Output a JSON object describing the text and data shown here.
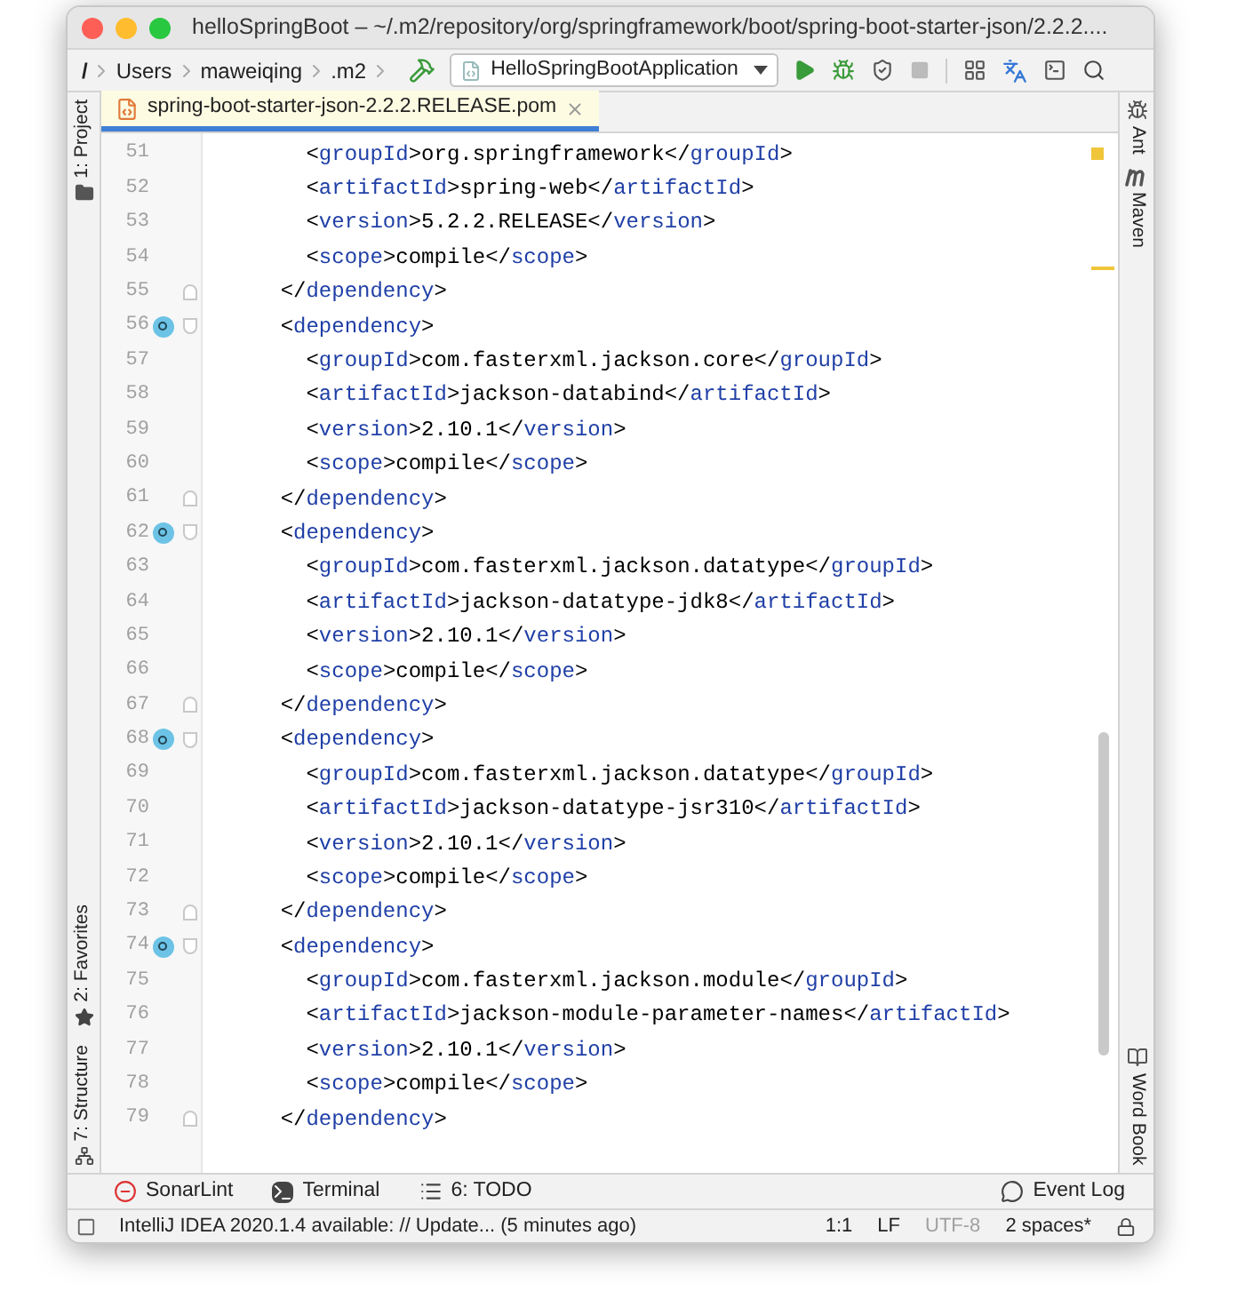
{
  "window": {
    "title": "helloSpringBoot – ~/.m2/repository/org/springframework/boot/spring-boot-starter-json/2.2.2...."
  },
  "breadcrumbs": [
    "/",
    "Users",
    "maweiqing",
    ".m2"
  ],
  "run_config": {
    "label": "HelloSpringBootApplication"
  },
  "left_sidebar": {
    "top": [
      {
        "label": "1: Project",
        "kind": "project"
      }
    ],
    "bottom": [
      {
        "label": "2: Favorites",
        "kind": "favorites"
      },
      {
        "label": "7: Structure",
        "kind": "structure"
      }
    ]
  },
  "tabs": [
    {
      "label": "spring-boot-starter-json-2.2.2.RELEASE.pom",
      "selected": true
    }
  ],
  "editor": {
    "lines": [
      {
        "number": "51",
        "text": "      <groupId>org.springframework</groupId>",
        "kind": "plain"
      },
      {
        "number": "52",
        "text": "      <artifactId>spring-web</artifactId>",
        "kind": "plain"
      },
      {
        "number": "53",
        "text": "      <version>5.2.2.RELEASE</version>",
        "kind": "plain"
      },
      {
        "number": "54",
        "text": "      <scope>compile</scope>",
        "kind": "plain"
      },
      {
        "number": "55",
        "text": "    </dependency>",
        "kind": "close"
      },
      {
        "number": "56",
        "text": "    <dependency>",
        "kind": "open"
      },
      {
        "number": "57",
        "text": "      <groupId>com.fasterxml.jackson.core</groupId>",
        "kind": "plain"
      },
      {
        "number": "58",
        "text": "      <artifactId>jackson-databind</artifactId>",
        "kind": "plain"
      },
      {
        "number": "59",
        "text": "      <version>2.10.1</version>",
        "kind": "plain"
      },
      {
        "number": "60",
        "text": "      <scope>compile</scope>",
        "kind": "plain"
      },
      {
        "number": "61",
        "text": "    </dependency>",
        "kind": "close"
      },
      {
        "number": "62",
        "text": "    <dependency>",
        "kind": "open"
      },
      {
        "number": "63",
        "text": "      <groupId>com.fasterxml.jackson.datatype</groupId>",
        "kind": "plain"
      },
      {
        "number": "64",
        "text": "      <artifactId>jackson-datatype-jdk8</artifactId>",
        "kind": "plain"
      },
      {
        "number": "65",
        "text": "      <version>2.10.1</version>",
        "kind": "plain"
      },
      {
        "number": "66",
        "text": "      <scope>compile</scope>",
        "kind": "plain"
      },
      {
        "number": "67",
        "text": "    </dependency>",
        "kind": "close"
      },
      {
        "number": "68",
        "text": "    <dependency>",
        "kind": "open"
      },
      {
        "number": "69",
        "text": "      <groupId>com.fasterxml.jackson.datatype</groupId>",
        "kind": "plain"
      },
      {
        "number": "70",
        "text": "      <artifactId>jackson-datatype-jsr310</artifactId>",
        "kind": "plain"
      },
      {
        "number": "71",
        "text": "      <version>2.10.1</version>",
        "kind": "plain"
      },
      {
        "number": "72",
        "text": "      <scope>compile</scope>",
        "kind": "plain"
      },
      {
        "number": "73",
        "text": "    </dependency>",
        "kind": "close"
      },
      {
        "number": "74",
        "text": "    <dependency>",
        "kind": "open"
      },
      {
        "number": "75",
        "text": "      <groupId>com.fasterxml.jackson.module</groupId>",
        "kind": "plain"
      },
      {
        "number": "76",
        "text": "      <artifactId>jackson-module-parameter-names</artifactId>",
        "kind": "plain"
      },
      {
        "number": "77",
        "text": "      <version>2.10.1</version>",
        "kind": "plain"
      },
      {
        "number": "78",
        "text": "      <scope>compile</scope>",
        "kind": "plain"
      },
      {
        "number": "79",
        "text": "    </dependency>",
        "kind": "close"
      }
    ]
  },
  "right_sidebar": {
    "top": [
      {
        "label": "Ant",
        "kind": "ant"
      },
      {
        "label": "Maven",
        "kind": "maven"
      }
    ],
    "bottom": [
      {
        "label": "Word Book",
        "kind": "book"
      }
    ]
  },
  "tool_windows": {
    "left": [
      {
        "label": "SonarLint",
        "kind": "sonarlint"
      },
      {
        "label": "Terminal",
        "kind": "terminal"
      },
      {
        "label": "6: TODO",
        "kind": "todo"
      }
    ],
    "right": [
      {
        "label": "Event Log",
        "kind": "event-log"
      }
    ]
  },
  "status_bar": {
    "message": "IntelliJ IDEA 2020.1.4 available: // Update... (5 minutes ago)",
    "items": [
      {
        "text": "1:1",
        "disabled": false
      },
      {
        "text": "LF",
        "disabled": false
      },
      {
        "text": "UTF-8",
        "disabled": true
      },
      {
        "text": "2 spaces*",
        "disabled": false
      }
    ]
  }
}
